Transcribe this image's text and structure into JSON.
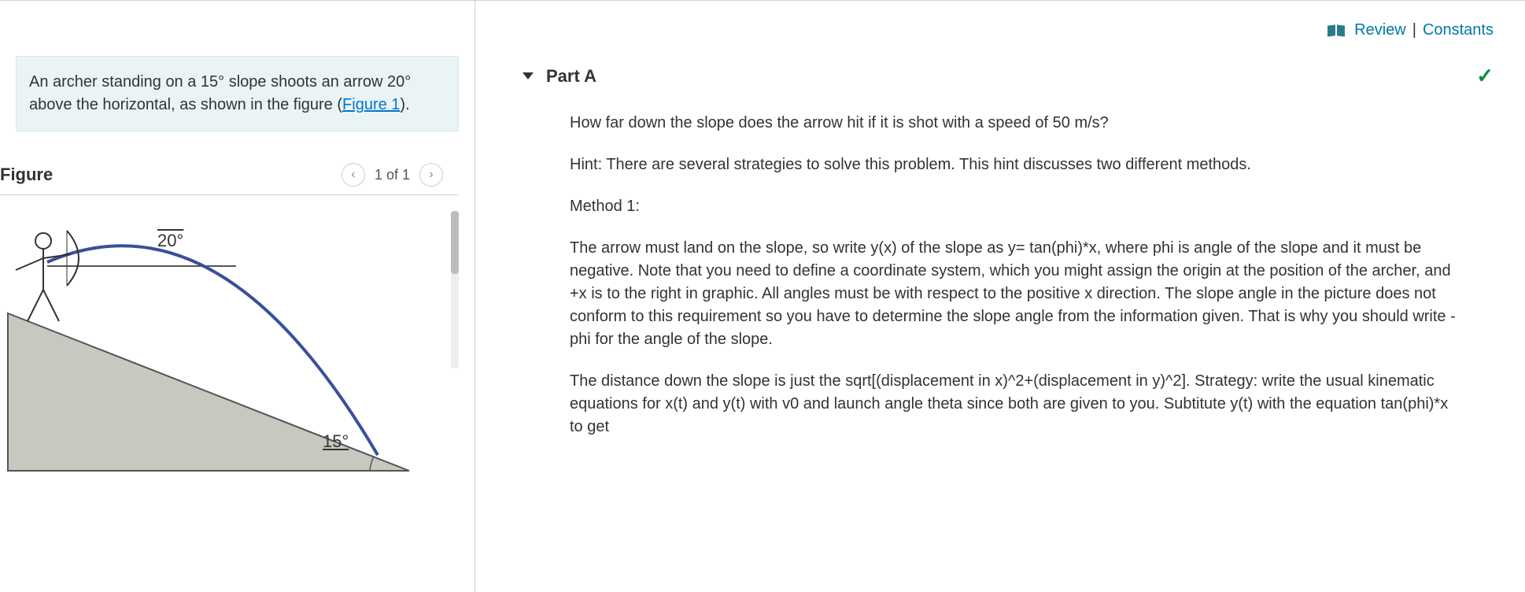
{
  "problem": {
    "text_before_link": "An archer standing on a 15° slope shoots an arrow 20° above the horizontal, as shown in the figure (",
    "figure_link": "Figure 1",
    "text_after_link": ")."
  },
  "figure": {
    "heading": "Figure",
    "pager_label": "1 of 1",
    "launch_angle_label": "20°",
    "slope_angle_label": "15°"
  },
  "top_links": {
    "review": "Review",
    "separator": "|",
    "constants": "Constants"
  },
  "part": {
    "title": "Part A",
    "question": "How far down the slope does the arrow hit if it is shot with a speed of 50 m/s?",
    "hint_intro": "Hint:  There are several strategies to solve this problem.  This hint discusses two different methods.",
    "method1_label": "Method 1:",
    "method1_para1": "The arrow must land on the slope, so write y(x) of the slope as y= tan(phi)*x, where phi is angle of the slope and it must be negative.  Note that you need to define a coordinate system, which you might assign the origin at the position of the archer, and +x is to the right in graphic.  All angles must be with respect to the positive x direction.  The slope angle in the picture does not conform to this requirement so you have to determine the slope angle from the information given.  That is why you should write -phi for the angle of the slope.",
    "method1_para2": "The distance down the slope is just the sqrt[(displacement in x)^2+(displacement in y)^2].   Strategy: write the usual kinematic equations for x(t) and y(t) with v0 and launch angle theta since both are given to you.  Subtitute y(t) with the equation tan(phi)*x to get"
  }
}
